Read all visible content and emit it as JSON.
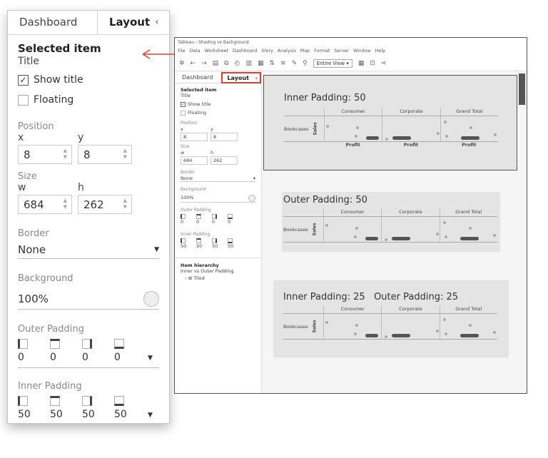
{
  "zoom_panel": {
    "tabs": [
      "Dashboard",
      "Layout"
    ],
    "selected_item_heading": "Selected item",
    "selected_item_name": "Title",
    "show_title_label": "Show title",
    "floating_label": "Floating",
    "position_label": "Position",
    "x_label": "x",
    "y_label": "y",
    "x_value": "8",
    "y_value": "8",
    "size_label": "Size",
    "w_label": "w",
    "h_label": "h",
    "w_value": "684",
    "h_value": "262",
    "border_label": "Border",
    "border_value": "None",
    "background_label": "Background",
    "background_value": "100%",
    "outer_padding_label": "Outer Padding",
    "outer_padding_values": [
      "0",
      "0",
      "0",
      "0"
    ],
    "inner_padding_label": "Inner Padding",
    "inner_padding_values": [
      "50",
      "50",
      "50",
      "50"
    ]
  },
  "window": {
    "title": "Tableau - Shading vs Background",
    "menus": [
      "File",
      "Data",
      "Worksheet",
      "Dashboard",
      "Story",
      "Analysis",
      "Map",
      "Format",
      "Server",
      "Window",
      "Help"
    ],
    "view_select": "Entire View",
    "side": {
      "tabs": [
        "Dashboard",
        "Layout"
      ],
      "selected_item_heading": "Selected item",
      "selected_item_name": "Title",
      "show_title_label": "Show title",
      "floating_label": "Floating",
      "position_label": "Position",
      "x_label": "x",
      "y_label": "y",
      "x_value": "8",
      "y_value": "8",
      "size_label": "Size",
      "w_label": "w",
      "h_label": "h",
      "w_value": "684",
      "h_value": "262",
      "border_label": "Border",
      "border_value": "None",
      "background_label": "Background",
      "background_value": "100%",
      "outer_padding_label": "Outer Padding",
      "outer_padding_values": [
        "0",
        "0",
        "0",
        "0"
      ],
      "inner_padding_label": "Inner Padding",
      "inner_padding_values": [
        "50",
        "50",
        "50",
        "50"
      ],
      "item_hierarchy_label": "Item hierarchy",
      "hierarchy_root": "Inner vs Outer Padding",
      "hierarchy_child": "Tiled"
    },
    "dashboard": {
      "panels": [
        {
          "title": "Inner Padding: 50"
        },
        {
          "title": "Outer Padding: 50"
        },
        {
          "title": "Inner Padding: 25   Outer Padding: 25"
        }
      ],
      "columns": [
        "Consumer",
        "Corporate",
        "Grand Total"
      ],
      "row_label": "Bookcases",
      "row_measure": "Sales",
      "x_axis_label": "Profit"
    }
  }
}
